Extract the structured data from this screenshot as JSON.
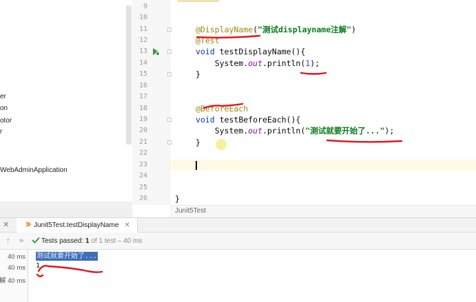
{
  "sidebar": {
    "tree_items": [
      "er",
      "on",
      "otor",
      "r",
      "WebAdminApplication"
    ]
  },
  "editor": {
    "line_numbers": [
      "9",
      "10",
      "11",
      "12",
      "13",
      "14",
      "15",
      "16",
      "17",
      "18",
      "19",
      "20",
      "21",
      "22",
      "23",
      "24",
      "25",
      "26"
    ],
    "lines": {
      "l11": {
        "annotation": "@DisplayName",
        "open": "(",
        "string": "\"测试displayname注解\"",
        "close": ")"
      },
      "l12": {
        "annotation": "@Test"
      },
      "l13": {
        "kw": "void",
        "rest": " testDisplayName(){"
      },
      "l14": {
        "pre": "    System.",
        "field": "out",
        "mid": ".println(",
        "num": "1",
        "end": ");"
      },
      "l15": {
        "text": "}"
      },
      "l18": {
        "annotation": "@BeforeEach"
      },
      "l19": {
        "kw": "void",
        "rest": " testBeforeEach(){"
      },
      "l20": {
        "pre": "    System.",
        "field": "out",
        "mid": ".println(",
        "string": "\"测试就要开始了...\"",
        "end": ");"
      },
      "l21": {
        "text": "}"
      },
      "l26": {
        "text": "}"
      }
    },
    "breadcrumb": "Junit5Test"
  },
  "run_panel": {
    "tab_label": "Junit5Test.testDisplayName",
    "status": {
      "label": "Tests passed:",
      "count": "1",
      "detail": "of 1 test – 40 ms"
    },
    "times": [
      "40 ms",
      "40 ms",
      "40 ms"
    ],
    "time_prefix": "解",
    "console_lines": [
      "测试就要开始了...",
      "1"
    ]
  },
  "colors": {
    "annotation": "#9e880d",
    "keyword": "#0033b3",
    "string": "#067d17",
    "number": "#1750eb",
    "field": "#871094",
    "pass_green": "#3c9a3c",
    "ink_red": "#e0141e",
    "console_selection": "#3e6fb8"
  },
  "icons": [
    "run-gutter-icon",
    "fold-icon",
    "close-icon",
    "test-class-icon",
    "arrow-up-icon",
    "double-chevron-icon",
    "check-icon"
  ]
}
